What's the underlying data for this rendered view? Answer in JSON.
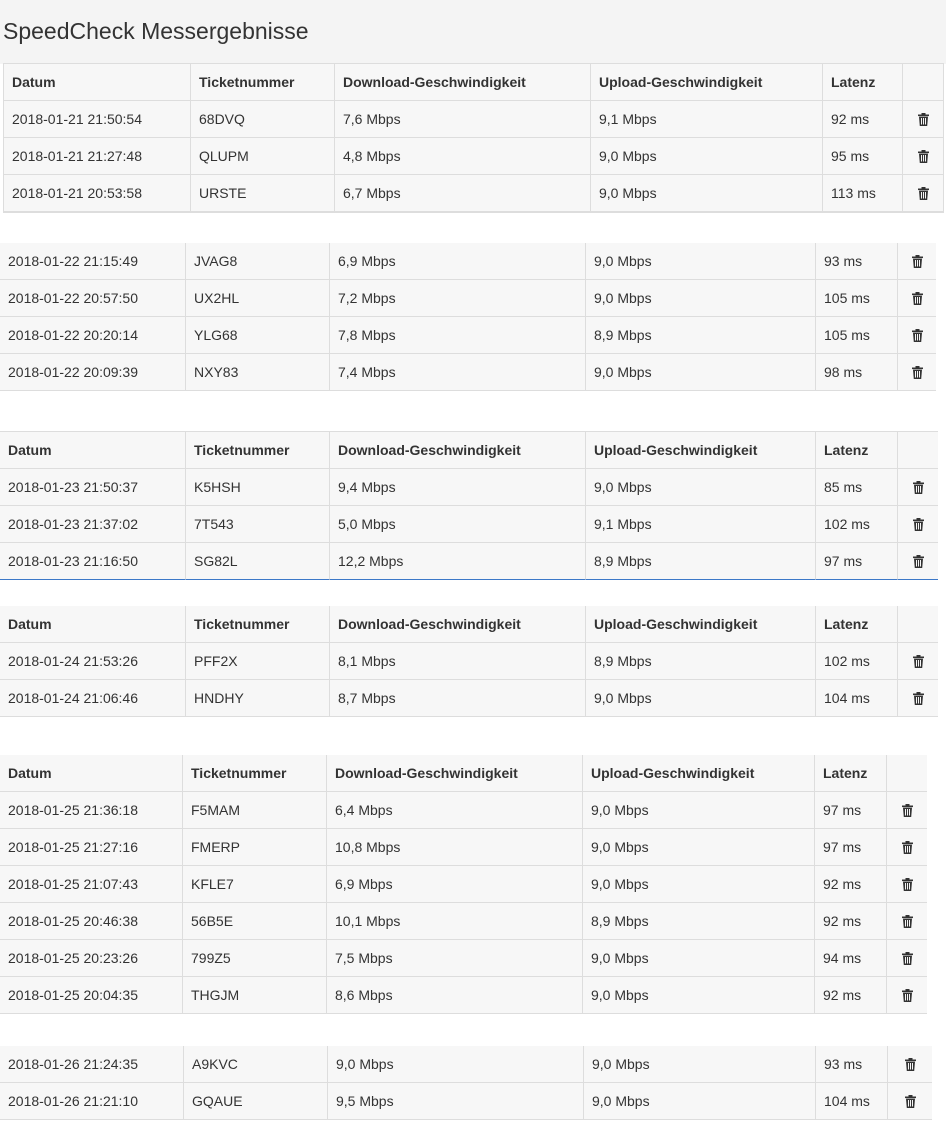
{
  "page": {
    "title": "SpeedCheck Messergebnisse"
  },
  "headers": [
    "Datum",
    "Ticketnummer",
    "Download-Geschwindigkeit",
    "Upload-Geschwindigkeit",
    "Latenz"
  ],
  "icons": {
    "delete": "trash-icon"
  },
  "sections": [
    {
      "show_header": true,
      "rows": [
        [
          "2018-01-21 21:50:54",
          "68DVQ",
          "7,6 Mbps",
          "9,1 Mbps",
          "92 ms"
        ],
        [
          "2018-01-21 21:27:48",
          "QLUPM",
          "4,8 Mbps",
          "9,0 Mbps",
          "95 ms"
        ],
        [
          "2018-01-21 20:53:58",
          "URSTE",
          "6,7 Mbps",
          "9,0 Mbps",
          "113 ms"
        ]
      ]
    },
    {
      "show_header": false,
      "rows": [
        [
          "2018-01-22 21:15:49",
          "JVAG8",
          "6,9 Mbps",
          "9,0 Mbps",
          "93 ms"
        ],
        [
          "2018-01-22 20:57:50",
          "UX2HL",
          "7,2 Mbps",
          "9,0 Mbps",
          "105 ms"
        ],
        [
          "2018-01-22 20:20:14",
          "YLG68",
          "7,8 Mbps",
          "8,9 Mbps",
          "105 ms"
        ],
        [
          "2018-01-22 20:09:39",
          "NXY83",
          "7,4 Mbps",
          "9,0 Mbps",
          "98 ms"
        ]
      ]
    },
    {
      "show_header": true,
      "rows": [
        [
          "2018-01-23 21:50:37",
          "K5HSH",
          "9,4 Mbps",
          "9,0 Mbps",
          "85 ms"
        ],
        [
          "2018-01-23 21:37:02",
          "7T543",
          "5,0 Mbps",
          "9,1 Mbps",
          "102 ms"
        ],
        [
          "2018-01-23 21:16:50",
          "SG82L",
          "12,2 Mbps",
          "8,9 Mbps",
          "97 ms"
        ]
      ]
    },
    {
      "show_header": true,
      "rows": [
        [
          "2018-01-24 21:53:26",
          "PFF2X",
          "8,1 Mbps",
          "8,9 Mbps",
          "102 ms"
        ],
        [
          "2018-01-24 21:06:46",
          "HNDHY",
          "8,7 Mbps",
          "9,0 Mbps",
          "104 ms"
        ]
      ]
    },
    {
      "show_header": true,
      "rows": [
        [
          "2018-01-25 21:36:18",
          "F5MAM",
          "6,4 Mbps",
          "9,0 Mbps",
          "97 ms"
        ],
        [
          "2018-01-25 21:27:16",
          "FMERP",
          "10,8 Mbps",
          "9,0 Mbps",
          "97 ms"
        ],
        [
          "2018-01-25 21:07:43",
          "KFLE7",
          "6,9 Mbps",
          "9,0 Mbps",
          "92 ms"
        ],
        [
          "2018-01-25 20:46:38",
          "56B5E",
          "10,1 Mbps",
          "8,9 Mbps",
          "92 ms"
        ],
        [
          "2018-01-25 20:23:26",
          "799Z5",
          "7,5 Mbps",
          "9,0 Mbps",
          "94 ms"
        ],
        [
          "2018-01-25 20:04:35",
          "THGJM",
          "8,6 Mbps",
          "9,0 Mbps",
          "92 ms"
        ]
      ]
    },
    {
      "show_header": false,
      "rows": [
        [
          "2018-01-26 21:24:35",
          "A9KVC",
          "9,0 Mbps",
          "9,0 Mbps",
          "93 ms"
        ],
        [
          "2018-01-26 21:21:10",
          "GQAUE",
          "9,5 Mbps",
          "9,0 Mbps",
          "104 ms"
        ]
      ]
    }
  ]
}
